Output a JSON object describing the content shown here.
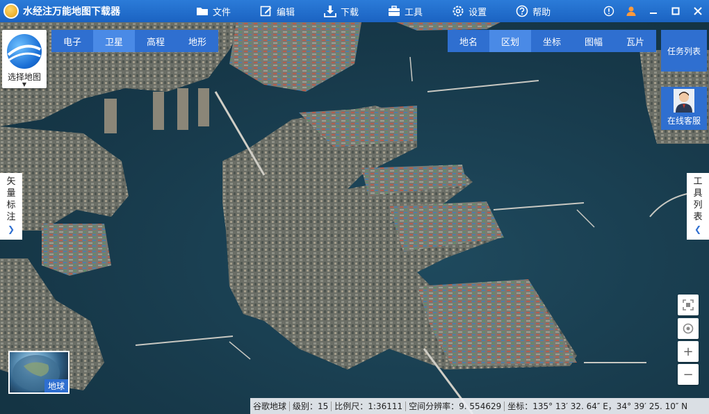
{
  "app": {
    "title": "水经注万能地图下载器"
  },
  "menu": [
    {
      "label": "文件",
      "icon": "folder-icon"
    },
    {
      "label": "编辑",
      "icon": "edit-icon"
    },
    {
      "label": "下载",
      "icon": "download-icon"
    },
    {
      "label": "工具",
      "icon": "toolbox-icon"
    },
    {
      "label": "设置",
      "icon": "gear-icon"
    },
    {
      "label": "帮助",
      "icon": "help-icon"
    }
  ],
  "select_map": {
    "label": "选择地图"
  },
  "layer_tabs": [
    {
      "label": "电子",
      "active": false
    },
    {
      "label": "卫星",
      "active": true
    },
    {
      "label": "高程",
      "active": false
    },
    {
      "label": "地形",
      "active": false
    }
  ],
  "tool_tabs": [
    {
      "label": "地名",
      "active": false
    },
    {
      "label": "区划",
      "active": true
    },
    {
      "label": "坐标",
      "active": false
    },
    {
      "label": "图幅",
      "active": false
    },
    {
      "label": "瓦片",
      "active": false
    }
  ],
  "side": {
    "task_list": "任务列表",
    "online_service": "在线客服",
    "vector_panel": [
      "矢",
      "量",
      "标",
      "注"
    ],
    "tools_panel": [
      "工",
      "具",
      "列",
      "表"
    ]
  },
  "earth": {
    "label": "地球"
  },
  "status": {
    "source": "谷歌地球",
    "level": "级别：15",
    "scale": "比例尺：1:36111",
    "resolution": "空间分辨率：9. 554629",
    "coords": "坐标：135° 13′ 32. 64″ E，34° 39′ 25. 10″ N"
  },
  "colors": {
    "accent": "#2f6fd0",
    "titlebar": "#1b63c2",
    "water": "#17394a"
  }
}
